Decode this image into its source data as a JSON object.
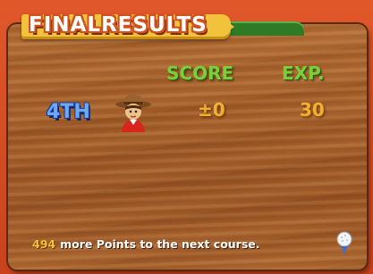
{
  "screen": {
    "title": "FINALRESULTS",
    "columns": {
      "score_label": "SCORE",
      "exp_label": "EXP."
    },
    "result": {
      "rank": "4TH",
      "score": "±0",
      "exp": "30",
      "character_icon": "golfer-avatar-icon"
    },
    "footer": {
      "points": "494",
      "message": "more Points to the next course."
    },
    "next_icon": "golf-ball-on-tee-icon"
  },
  "colors": {
    "frame_red": "#d24a1f",
    "wood": "#a25c28",
    "title_banner": "#f2c23c",
    "header_green": "#7ccf3a",
    "rank_blue": "#6fa8f0",
    "value_gold": "#f3b02e"
  }
}
